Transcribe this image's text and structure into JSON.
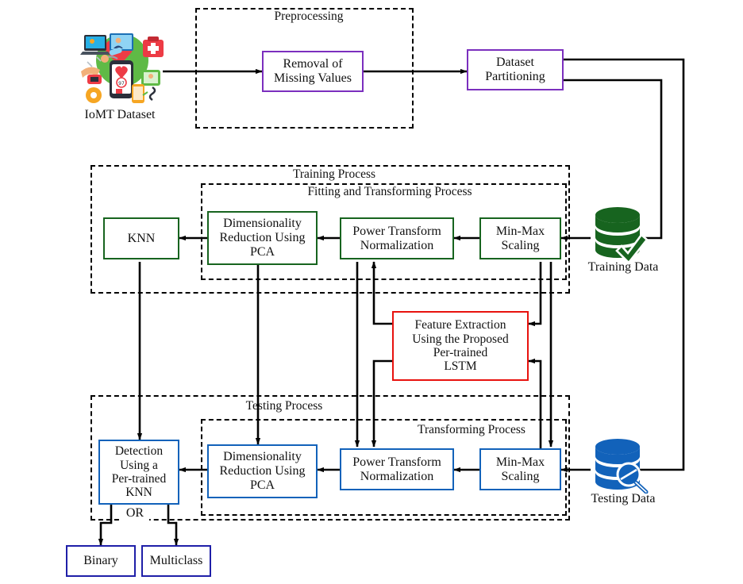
{
  "diagram": {
    "title": "IoMT intrusion detection pipeline flowchart",
    "groups": [
      {
        "id": "preprocessing",
        "label": "Preprocessing"
      },
      {
        "id": "training_process",
        "label": "Training Process"
      },
      {
        "id": "fitting_transforming",
        "label": "Fitting and Transforming Process"
      },
      {
        "id": "testing_process",
        "label": "Testing Process"
      },
      {
        "id": "transforming",
        "label": "Transforming Process"
      }
    ],
    "nodes": {
      "iomt_dataset": {
        "label": "IoMT Dataset",
        "color": "#000000",
        "icon": "iomt-dataset-illustration"
      },
      "removal_missing_values": {
        "label": "Removal of\nMissing Values",
        "color": "#7B2FBE"
      },
      "dataset_partitioning": {
        "label": "Dataset\nPartitioning",
        "color": "#7B2FBE"
      },
      "train_knn": {
        "label": "KNN",
        "color": "#17641F"
      },
      "train_pca": {
        "label": "Dimensionality\nReduction Using\nPCA",
        "color": "#17641F"
      },
      "train_power_transform": {
        "label": "Power Transform\nNormalization",
        "color": "#17641F"
      },
      "train_minmax": {
        "label": "Min-Max\nScaling",
        "color": "#17641F"
      },
      "training_data": {
        "label": "Training Data",
        "color": "#17641F",
        "icon": "database-check-icon"
      },
      "feature_extraction": {
        "label": "Feature Extraction\nUsing the Proposed\nPer-trained\nLSTM",
        "color": "#E8120E"
      },
      "test_detection": {
        "label": "Detection\nUsing a\nPer-trained\nKNN",
        "color": "#1262BA"
      },
      "test_pca": {
        "label": "Dimensionality\nReduction Using\nPCA",
        "color": "#1262BA"
      },
      "test_power_transform": {
        "label": "Power Transform\nNormalization",
        "color": "#1262BA"
      },
      "test_minmax": {
        "label": "Min-Max\nScaling",
        "color": "#1262BA"
      },
      "testing_data": {
        "label": "Testing Data",
        "color": "#1262BA",
        "icon": "database-search-icon"
      },
      "or_connector": {
        "label": "OR",
        "color": "#000000"
      },
      "binary": {
        "label": "Binary",
        "color": "#1F1FA8"
      },
      "multiclass": {
        "label": "Multiclass",
        "color": "#1F1FA8"
      }
    },
    "edges": [
      {
        "from": "iomt_dataset",
        "to": "removal_missing_values"
      },
      {
        "from": "removal_missing_values",
        "to": "dataset_partitioning"
      },
      {
        "from": "dataset_partitioning",
        "to": "training_data"
      },
      {
        "from": "dataset_partitioning",
        "to": "testing_data"
      },
      {
        "from": "training_data",
        "to": "train_minmax"
      },
      {
        "from": "train_minmax",
        "to": "train_power_transform"
      },
      {
        "from": "train_power_transform",
        "to": "train_pca"
      },
      {
        "from": "train_pca",
        "to": "train_knn"
      },
      {
        "from": "train_minmax",
        "to": "feature_extraction"
      },
      {
        "from": "feature_extraction",
        "to": "train_power_transform"
      },
      {
        "from": "feature_extraction",
        "to": "test_power_transform"
      },
      {
        "from": "test_minmax",
        "to": "feature_extraction"
      },
      {
        "from": "testing_data",
        "to": "test_minmax"
      },
      {
        "from": "train_minmax",
        "to": "test_minmax"
      },
      {
        "from": "test_minmax",
        "to": "test_power_transform"
      },
      {
        "from": "test_power_transform",
        "to": "test_pca"
      },
      {
        "from": "test_pca",
        "to": "test_detection"
      },
      {
        "from": "train_power_transform",
        "to": "test_power_transform"
      },
      {
        "from": "train_pca",
        "to": "test_pca"
      },
      {
        "from": "train_knn",
        "to": "test_detection"
      },
      {
        "from": "test_detection",
        "to": "binary"
      },
      {
        "from": "test_detection",
        "to": "multiclass"
      }
    ]
  }
}
